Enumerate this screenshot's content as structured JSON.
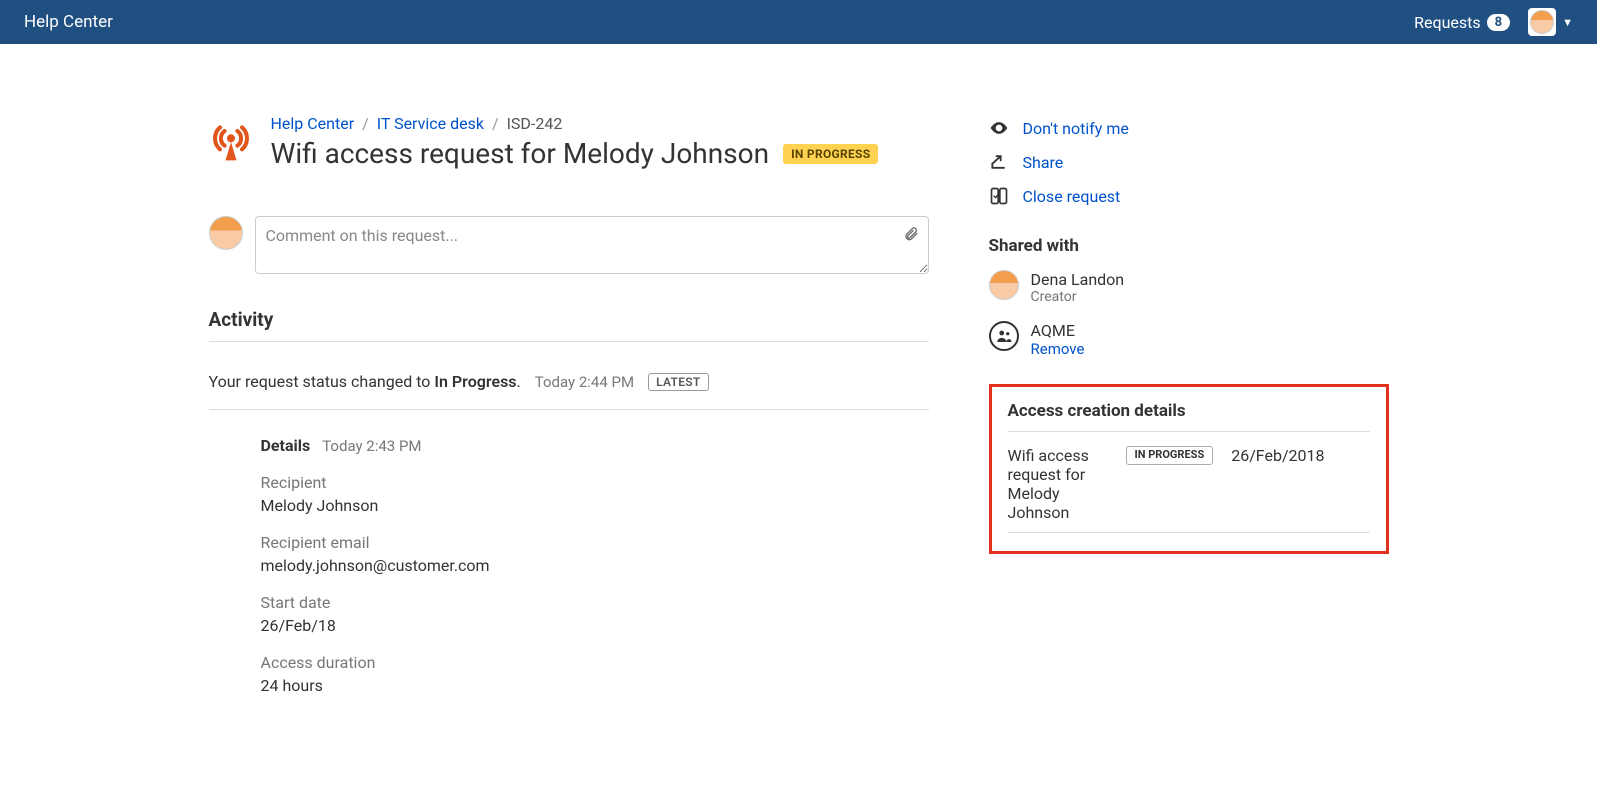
{
  "topbar": {
    "brand": "Help Center",
    "requests_label": "Requests",
    "requests_count": "8"
  },
  "breadcrumb": {
    "root": "Help Center",
    "project": "IT Service desk",
    "key": "ISD-242"
  },
  "title": "Wifi access request for Melody Johnson",
  "status_badge": "IN PROGRESS",
  "comment": {
    "placeholder": "Comment on this request..."
  },
  "activity": {
    "heading": "Activity",
    "entry": {
      "prefix": "Your request status changed to ",
      "status": "In Progress",
      "suffix": ".",
      "time": "Today 2:44 PM",
      "badge": "LATEST"
    },
    "details": {
      "heading": "Details",
      "time": "Today 2:43 PM",
      "fields": {
        "recipient_label": "Recipient",
        "recipient_value": "Melody Johnson",
        "email_label": "Recipient email",
        "email_value": "melody.johnson@customer.com",
        "start_label": "Start date",
        "start_value": "26/Feb/18",
        "duration_label": "Access duration",
        "duration_value": "24 hours"
      }
    }
  },
  "actions": {
    "dont_notify": "Don't notify me",
    "share": "Share",
    "close_request": "Close request"
  },
  "shared": {
    "heading": "Shared with",
    "person_name": "Dena Landon",
    "person_role": "Creator",
    "group_name": "AQME",
    "remove_label": "Remove"
  },
  "access_panel": {
    "heading": "Access creation details",
    "title": "Wifi access request for Melody Johnson",
    "status": "IN PROGRESS",
    "date": "26/Feb/2018"
  }
}
